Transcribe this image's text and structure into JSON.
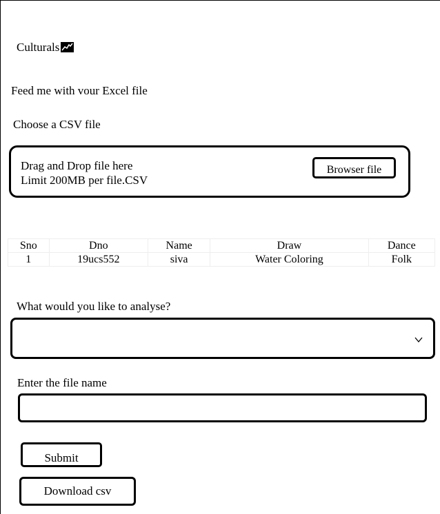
{
  "app": {
    "title": "Culturals",
    "title_icon": "chart-icon",
    "subtitle": "Feed me with vour Excel file"
  },
  "upload": {
    "label": "Choose a CSV file",
    "drop_line1": "Drag and Drop file here",
    "drop_line2": "Limit 200MB per file.CSV",
    "browse_label": "Browser file"
  },
  "table": {
    "columns": [
      "Sno",
      "Dno",
      "Name",
      "Draw",
      "Dance"
    ],
    "rows": [
      [
        "1",
        "19ucs552",
        "siva",
        "Water Coloring",
        "Folk"
      ]
    ]
  },
  "analyse": {
    "label": "What would you like to analyse?",
    "selected": "",
    "chevron_icon": "chevron-down-icon"
  },
  "filename": {
    "label": "Enter the file name",
    "value": "",
    "placeholder": ""
  },
  "actions": {
    "submit_label": "Submit",
    "download_label": "Download csv"
  }
}
